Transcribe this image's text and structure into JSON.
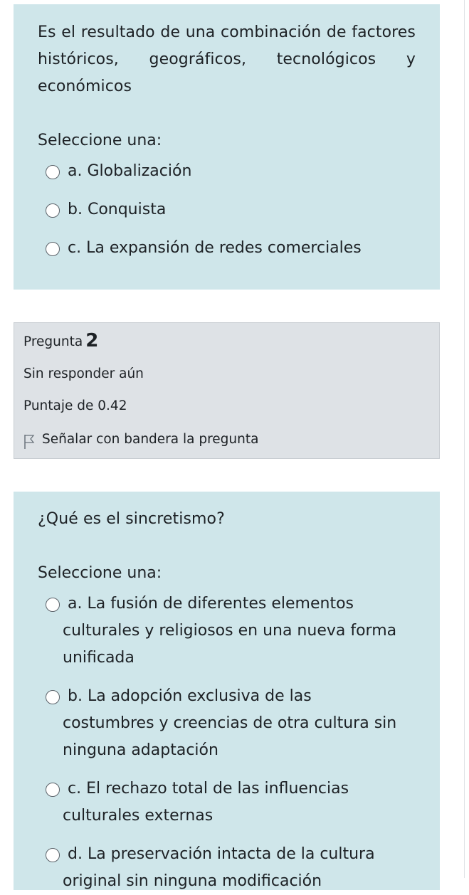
{
  "question1": {
    "text": "Es el resultado de una combinación de factores históricos, geográficos, tecnológicos y económicos",
    "prompt": "Seleccione una:",
    "options": [
      {
        "label": "a. Globalización"
      },
      {
        "label": "b. Conquista"
      },
      {
        "label": "c. La expansión de redes comerciales"
      }
    ]
  },
  "question2_info": {
    "label": "Pregunta",
    "number": "2",
    "state": "Sin responder aún",
    "grade": "Puntaje de 0.42",
    "flag_label": "Señalar con bandera la pregunta",
    "flag_icon": "flag-outline-icon"
  },
  "question2": {
    "text": "¿Qué es el sincretismo?",
    "prompt": "Seleccione una:",
    "options": [
      {
        "label": "a. La fusión de diferentes elementos culturales y religiosos en una nueva forma unificada"
      },
      {
        "label": "b. La adopción exclusiva de las costumbres y creencias de otra cultura sin ninguna adaptación"
      },
      {
        "label": "c. El rechazo total de las influencias culturales externas"
      },
      {
        "label": "d. La preservación intacta de la cultura original sin ninguna modificación"
      }
    ]
  }
}
